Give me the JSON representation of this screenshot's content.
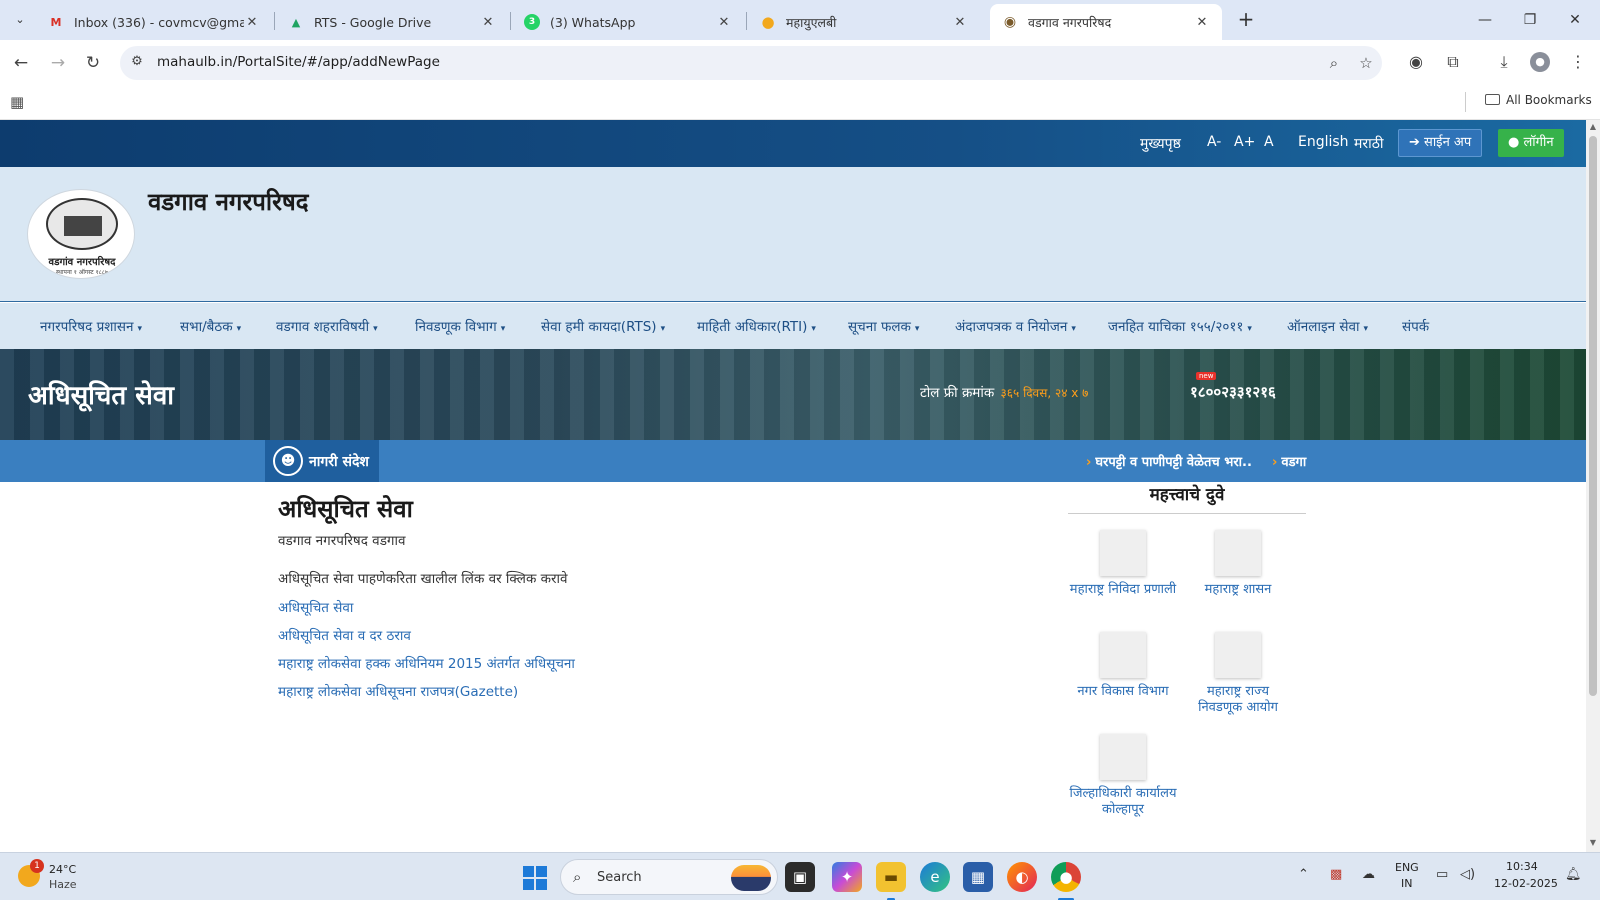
{
  "browser": {
    "tabs": [
      {
        "title": "Inbox (336) - covmcv@gmail.co",
        "favicon": "gmail-icon",
        "fav_glyph": "M",
        "fav_color": "#d93025"
      },
      {
        "title": "RTS - Google Drive",
        "favicon": "drive-icon",
        "fav_glyph": "▲",
        "fav_color": "#1fa463"
      },
      {
        "title": "(3) WhatsApp",
        "favicon": "whatsapp-icon",
        "fav_glyph": "3",
        "fav_color": "#25d366"
      },
      {
        "title": "महायुएलबी",
        "favicon": "mahaulb-icon",
        "fav_glyph": "●",
        "fav_color": "#f2a81d"
      },
      {
        "title": "वडगाव नगरपरिषद",
        "favicon": "vadgaon-icon",
        "fav_glyph": "◉",
        "fav_color": "#7a5a2a"
      }
    ],
    "url": "mahaulb.in/PortalSite/#/app/addNewPage",
    "bookmarks_label": "All Bookmarks"
  },
  "site": {
    "top_links": {
      "home": "मुख्यपृष्ठ",
      "font_small": "A-",
      "font_large": "A+",
      "font_normal": "A",
      "english": "English",
      "marathi": "मराठी",
      "signup": "➔ साईन अप",
      "login": "● लॉगीन"
    },
    "logo_text": "वडगांव नगरपरिषद",
    "logo_sub": "स्थापना १ ऑगस्ट १८८७",
    "title": "वडगाव नगरपरिषद",
    "nav": [
      "नगरपरिषद प्रशासन",
      "सभा/बैठक",
      "वडगाव शहराविषयी",
      "निवडणूक विभाग",
      "सेवा हमी कायदा(RTS)",
      "माहिती अधिकार(RTI)",
      "सूचना फलक",
      "अंदाजपत्रक व नियोजन",
      "जनहित याचिका १५५/२०११",
      "ऑनलाइन सेवा",
      "संपर्क"
    ],
    "hero": {
      "title": "अधिसूचित सेवा",
      "toll_label": "टोल फ्री क्रमांक",
      "toll_hours": "३६५ दिवस, २४ x ७",
      "new_badge": "new",
      "toll_number": "१८००२३३१२१६"
    },
    "ticker": {
      "label": "नागरी संदेश",
      "items": [
        "घरपट्टी व पाणीपट्टी वेळेतच भरा..",
        "वडगा"
      ]
    },
    "content": {
      "title": "अधिसूचित सेवा",
      "subtitle": "वडगाव नगरपरिषद वडगाव",
      "description": "अधिसूचित सेवा पाहणेकरिता खालील लिंक वर क्लिक करावे",
      "links": [
        "अधिसूचित सेवा",
        "अधिसूचित सेवा व दर ठराव",
        "महाराष्ट्र लोकसेवा हक्क अधिनियम 2015 अंतर्गत अधिसूचना",
        "महाराष्ट्र लोकसेवा अधिसूचना राजपत्र(Gazette)"
      ]
    },
    "important_links": {
      "title": "महत्त्वाचे दुवे",
      "items": [
        "महाराष्ट्र निविदा प्रणाली",
        "महाराष्ट्र शासन",
        "नगर विकास विभाग",
        "महाराष्ट्र राज्य निवडणूक आयोग",
        "जिल्हाधिकारी कार्यालय कोल्हापूर"
      ]
    }
  },
  "taskbar": {
    "weather_temp": "24°C",
    "weather_cond": "Haze",
    "weather_badge": "1",
    "search_placeholder": "Search",
    "lang_top": "ENG",
    "lang_bottom": "IN",
    "time": "10:34",
    "date": "12-02-2025"
  }
}
